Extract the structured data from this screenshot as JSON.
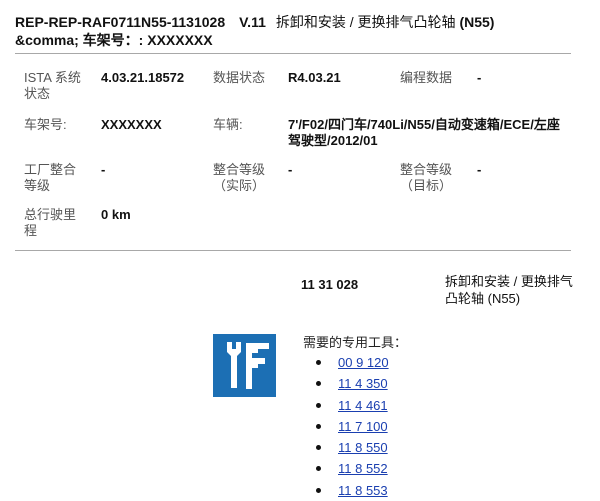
{
  "header": {
    "doc_code": "REP-REP-RAF0711N55-1131028",
    "version": "V.11",
    "job_title_cn": "拆卸和安装 / 更换排气凸轮轴",
    "job_engine": "(N55)",
    "line2": "&comma; 车架号：: XXXXXXX"
  },
  "info": {
    "ista_label": "ISTA 系统状态",
    "ista_value": "4.03.21.18572",
    "data_status_label": "数据状态",
    "data_status_value": "R4.03.21",
    "prog_data_label": "编程数据",
    "prog_data_value": "-",
    "vin_label": "车架号:",
    "vin_value": "XXXXXXX",
    "vehicle_label": "车辆:",
    "vehicle_value": "7'/F02/四门车/740Li/N55/自动变速箱/ECE/左座驾驶型/2012/01",
    "factory_level_label": "工厂整合等级",
    "factory_level_value": "-",
    "level_actual_label": "整合等级（实际）",
    "level_actual_value": "-",
    "level_target_label": "整合等级（目标）",
    "level_target_value": "-",
    "mileage_label": "总行驶里程",
    "mileage_value": "0 km"
  },
  "operation": {
    "number": "11 31 028",
    "description": "拆卸和安装 / 更换排气凸轮轴 (N55)"
  },
  "tools": {
    "heading": "需要的专用工具：",
    "icon": "special-tool-icon",
    "items": [
      "00 9 120",
      "11 4 350",
      "11 4 461",
      "11 7 100",
      "11 8 550",
      "11 8 552",
      "11 8 553"
    ]
  },
  "colors": {
    "icon_blue": "#1c6fb4",
    "link_blue": "#1a3fb0",
    "rule_gray": "#a8a8a8"
  }
}
